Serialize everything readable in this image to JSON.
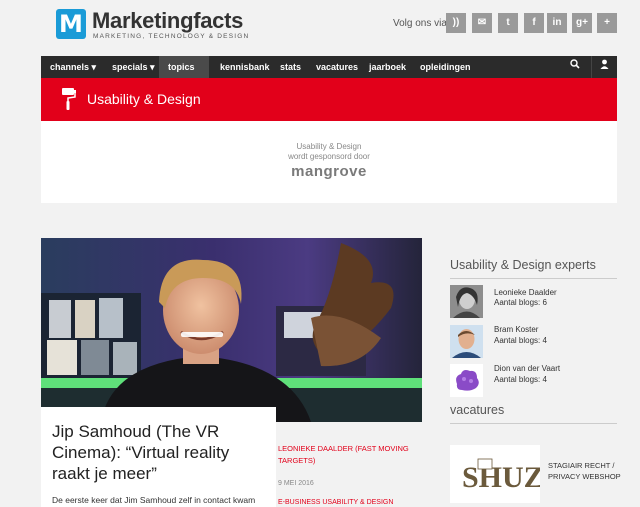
{
  "header": {
    "logo_letter": "M",
    "brand": "Marketingfacts",
    "tagline": "MARKETING, TECHNOLOGY & DESIGN",
    "follow_label": "Volg ons via",
    "social": [
      {
        "icon": "rss-icon",
        "glyph": "))"
      },
      {
        "icon": "mail-icon",
        "glyph": "✉"
      },
      {
        "icon": "twitter-icon",
        "glyph": "t"
      },
      {
        "icon": "facebook-icon",
        "glyph": "f"
      },
      {
        "icon": "linkedin-icon",
        "glyph": "in"
      },
      {
        "icon": "google-plus-icon",
        "glyph": "g+"
      },
      {
        "icon": "plus-icon",
        "glyph": "+"
      }
    ]
  },
  "nav": {
    "items": [
      {
        "label": "channels ▾"
      },
      {
        "label": "specials ▾"
      },
      {
        "label": "topics ▾"
      },
      {
        "label": "kennisbank"
      },
      {
        "label": "stats"
      },
      {
        "label": "vacatures"
      },
      {
        "label": "jaarboek"
      },
      {
        "label": "opleidingen"
      }
    ],
    "active_index": 2,
    "search_glyph": "⚲",
    "user_glyph": "👤"
  },
  "banner": {
    "title": "Usability & Design"
  },
  "sponsor": {
    "line1": "Usability & Design",
    "line2": "wordt gesponsord door",
    "logo_text": "mangrove"
  },
  "article": {
    "title": "Jip Samhoud (The VR Cinema): “Virtual reality raakt je meer”",
    "excerpt": "De eerste keer dat Jim Samhoud zelf in contact kwam",
    "author": "LEONIEKE DAALDER (FAST MOVING TARGETS)",
    "date": "9 MEI 2016",
    "category": "E-BUSINESS USABILITY & DESIGN"
  },
  "sidebar": {
    "experts_heading": "Usability & Design experts",
    "experts": [
      {
        "name": "Leonieke Daalder",
        "count": "Aantal blogs: 6"
      },
      {
        "name": "Bram Koster",
        "count": "Aantal blogs: 4"
      },
      {
        "name": "Dion van der Vaart",
        "count": "Aantal blogs: 4"
      }
    ],
    "vacatures_heading": "vacatures",
    "vacancy_logo": "SHUZ.nl",
    "vacancy_text": "STAGIAIR RECHT / PRIVACY WEBSHOP"
  },
  "colors": {
    "accent_red": "#e2001a",
    "logo_blue": "#1a9bd7",
    "nav_bg": "#2b2b2b"
  }
}
